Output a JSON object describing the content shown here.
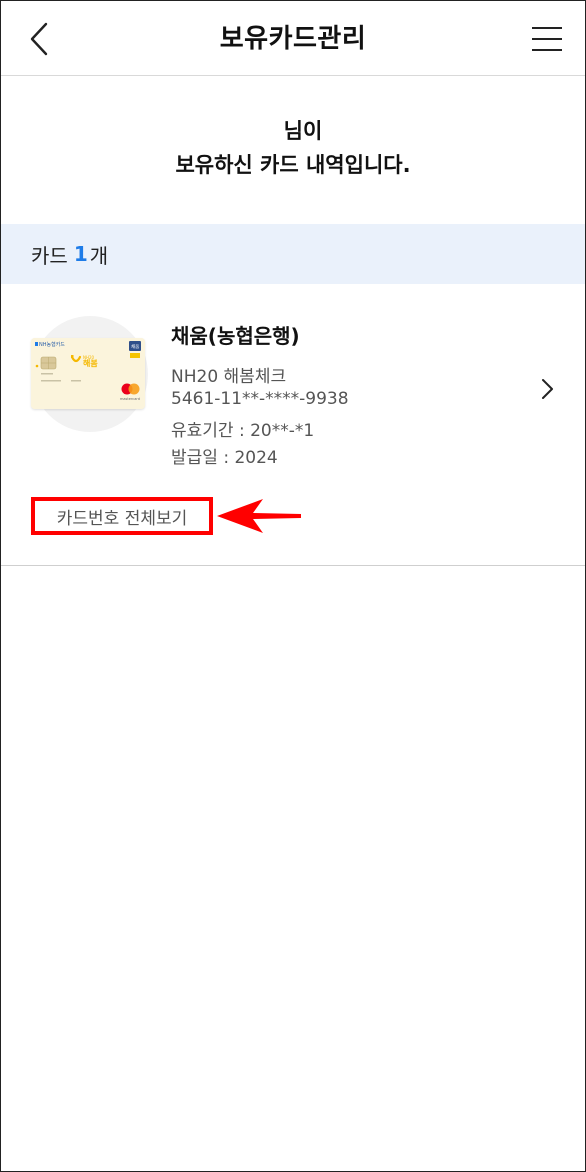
{
  "header": {
    "title": "보유카드관리"
  },
  "greeting": {
    "line1": "님이",
    "line2": "보유하신 카드 내역입니다."
  },
  "count_bar": {
    "prefix": "카드",
    "count": "1",
    "suffix": "개"
  },
  "card": {
    "name": "채움(농협은행)",
    "product": "NH20 해봄체크",
    "number": "5461-11**-****-9938",
    "expiry": "유효기간 : 20**-*1",
    "issued": "발급일 : 2024",
    "image": {
      "bank_logo": "NH농협카드",
      "brand": "해봄",
      "badge": "채움",
      "network": "mastercard"
    }
  },
  "actions": {
    "view_full_number": "카드번호 전체보기"
  },
  "colors": {
    "accent": "#1e7ce8",
    "count_bar_bg": "#eaf1fb",
    "annotation": "#ff0000"
  },
  "icons": {
    "back": "chevron-left-icon",
    "menu": "hamburger-menu-icon",
    "more": "chevron-right-icon"
  }
}
